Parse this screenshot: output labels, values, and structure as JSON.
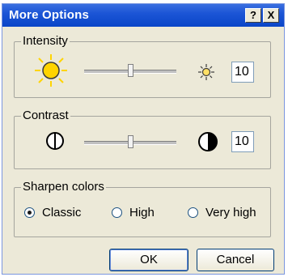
{
  "window": {
    "title": "More Options",
    "help_label": "?",
    "close_label": "X"
  },
  "intensity": {
    "group_label": "Intensity",
    "value": "10",
    "slider_level": 0.5,
    "low_icon": "sun-large-icon",
    "high_icon": "sun-small-icon"
  },
  "contrast": {
    "group_label": "Contrast",
    "value": "10",
    "slider_level": 0.5,
    "low_icon": "contrast-low-icon",
    "high_icon": "contrast-high-icon"
  },
  "sharpen": {
    "group_label": "Sharpen colors",
    "options": [
      "Classic",
      "High",
      "Very high"
    ],
    "selected": "Classic"
  },
  "buttons": {
    "ok_label": "OK",
    "cancel_label": "Cancel"
  },
  "colors": {
    "title_bar": "#0a46c8",
    "window_bg": "#ece9d8",
    "sun_yellow": "#ffd400"
  }
}
